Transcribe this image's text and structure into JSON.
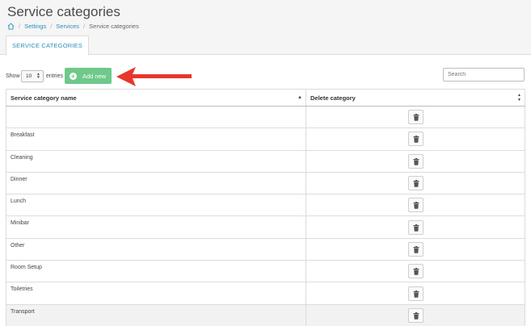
{
  "header": {
    "title": "Service categories",
    "breadcrumb": [
      "Settings",
      "Services",
      "Service categories"
    ]
  },
  "tabs": [
    {
      "label": "SERVICE CATEGORIES",
      "active": true
    }
  ],
  "controls": {
    "show_label": "Show",
    "entries_value": "10",
    "entries_label": "entries",
    "add_button_label": "Add new",
    "search_placeholder": "Search"
  },
  "table": {
    "columns": [
      "Service category name",
      "Delete category"
    ],
    "rows": [
      {
        "name": ""
      },
      {
        "name": "Breakfast"
      },
      {
        "name": "Cleaning"
      },
      {
        "name": "Dinner"
      },
      {
        "name": "Lunch"
      },
      {
        "name": "Minibar"
      },
      {
        "name": "Other"
      },
      {
        "name": "Room Setup"
      },
      {
        "name": "Toiletries"
      },
      {
        "name": "Transport"
      }
    ]
  },
  "icons": {
    "home": "home-icon",
    "add": "plus-circle-icon",
    "delete": "trash-icon",
    "annotation": "red-arrow-icon"
  },
  "colors": {
    "accent": "#2a8fb8",
    "add_button": "#6ec98a",
    "annotation_arrow": "#e8362a"
  }
}
